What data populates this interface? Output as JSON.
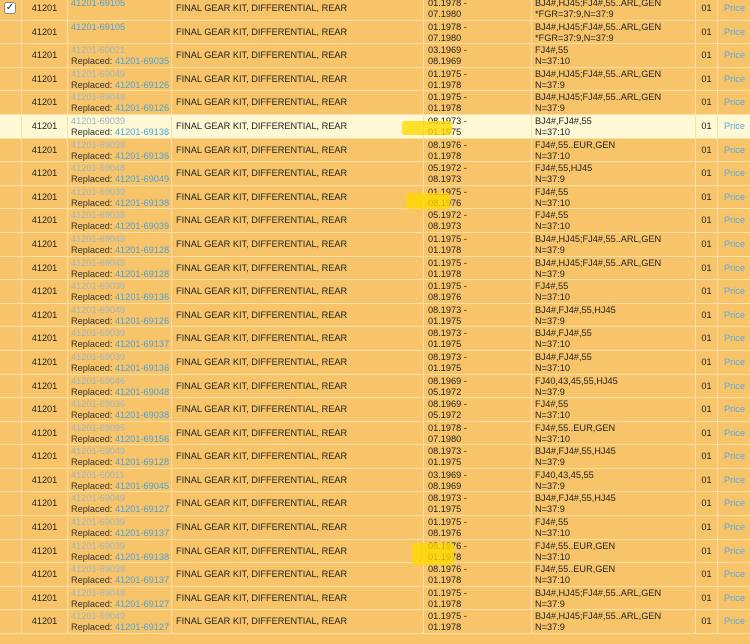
{
  "price_label": "Price",
  "replaced_label": "Replaced:",
  "checked_mark": "✓",
  "rows": [
    {
      "catalog": "41201",
      "part": "41201-69105",
      "replaced": "",
      "name": "FINAL GEAR KIT, DIFFERENTIAL, REAR",
      "date1": "01.1978 -",
      "date2": "07.1980",
      "app1": "BJ4#,HJ45;FJ4#,55..ARL,GEN",
      "app2": "*FGR=37:9,N=37:9",
      "qty": "01",
      "checked": true
    },
    {
      "catalog": "41201",
      "part": "41201-69105",
      "replaced": "",
      "name": "FINAL GEAR KIT, DIFFERENTIAL, REAR",
      "date1": "01.1978 -",
      "date2": "07.1980",
      "app1": "BJ4#,HJ45;FJ4#,55..ARL,GEN",
      "app2": "*FGR=37:9,N=37:9",
      "qty": "01"
    },
    {
      "catalog": "41201",
      "part": "41201-60021",
      "replaced": "41201-69035",
      "name": "FINAL GEAR KIT, DIFFERENTIAL, REAR",
      "date1": "03.1969 -",
      "date2": "08.1969",
      "app1": "FJ4#,55",
      "app2": "N=37:10",
      "qty": "01"
    },
    {
      "catalog": "41201",
      "part": "41201-69049",
      "replaced": "41201-69126",
      "name": "FINAL GEAR KIT, DIFFERENTIAL, REAR",
      "date1": "01.1975 -",
      "date2": "01.1978",
      "app1": "BJ4#,HJ45;FJ4#,55..ARL,GEN",
      "app2": "N=37:9",
      "qty": "01"
    },
    {
      "catalog": "41201",
      "part": "41201-69049",
      "replaced": "41201-69126",
      "name": "FINAL GEAR KIT, DIFFERENTIAL, REAR",
      "date1": "01.1975 -",
      "date2": "01.1978",
      "app1": "BJ4#,HJ45;FJ4#,55..ARL,GEN",
      "app2": "N=37:9",
      "qty": "01"
    },
    {
      "catalog": "41201",
      "part": "41201-69039",
      "replaced": "41201-69138",
      "name": "FINAL GEAR KIT, DIFFERENTIAL, REAR",
      "date1": "08.1973 -",
      "date2": "01.1975",
      "app1": "BJ4#,FJ4#,55",
      "app2": "N=37:10",
      "qty": "01",
      "highlight": true
    },
    {
      "catalog": "41201",
      "part": "41201-69039",
      "replaced": "41201-69136",
      "name": "FINAL GEAR KIT, DIFFERENTIAL, REAR",
      "date1": "08.1976 -",
      "date2": "01.1978",
      "app1": "FJ4#,55..EUR,GEN",
      "app2": "N=37:10",
      "qty": "01"
    },
    {
      "catalog": "41201",
      "part": "41201-69048",
      "replaced": "41201-69049",
      "name": "FINAL GEAR KIT, DIFFERENTIAL, REAR",
      "date1": "05.1972 -",
      "date2": "08.1973",
      "app1": "FJ4#,55,HJ45",
      "app2": "N=37:9",
      "qty": "01"
    },
    {
      "catalog": "41201",
      "part": "41201-69039",
      "replaced": "41201-69138",
      "name": "FINAL GEAR KIT, DIFFERENTIAL, REAR",
      "date1": "01.1975 -",
      "date2": "08.1976",
      "app1": "FJ4#,55",
      "app2": "N=37:10",
      "qty": "01"
    },
    {
      "catalog": "41201",
      "part": "41201-69038",
      "replaced": "41201-69039",
      "name": "FINAL GEAR KIT, DIFFERENTIAL, REAR",
      "date1": "05.1972 -",
      "date2": "08.1973",
      "app1": "FJ4#,55",
      "app2": "N=37:10",
      "qty": "01"
    },
    {
      "catalog": "41201",
      "part": "41201-69049",
      "replaced": "41201-69128",
      "name": "FINAL GEAR KIT, DIFFERENTIAL, REAR",
      "date1": "01.1975 -",
      "date2": "01.1978",
      "app1": "BJ4#,HJ45;FJ4#,55..ARL,GEN",
      "app2": "N=37:9",
      "qty": "01"
    },
    {
      "catalog": "41201",
      "part": "41201-69049",
      "replaced": "41201-69128",
      "name": "FINAL GEAR KIT, DIFFERENTIAL, REAR",
      "date1": "01.1975 -",
      "date2": "01.1978",
      "app1": "BJ4#,HJ45;FJ4#,55..ARL,GEN",
      "app2": "N=37:9",
      "qty": "01"
    },
    {
      "catalog": "41201",
      "part": "41201-69039",
      "replaced": "41201-69136",
      "name": "FINAL GEAR KIT, DIFFERENTIAL, REAR",
      "date1": "01.1975 -",
      "date2": "08.1976",
      "app1": "FJ4#,55",
      "app2": "N=37:10",
      "qty": "01"
    },
    {
      "catalog": "41201",
      "part": "41201-69049",
      "replaced": "41201-69126",
      "name": "FINAL GEAR KIT, DIFFERENTIAL, REAR",
      "date1": "08.1973 -",
      "date2": "01.1975",
      "app1": "BJ4#,FJ4#,55,HJ45",
      "app2": "N=37:9",
      "qty": "01"
    },
    {
      "catalog": "41201",
      "part": "41201-69039",
      "replaced": "41201-69137",
      "name": "FINAL GEAR KIT, DIFFERENTIAL, REAR",
      "date1": "08.1973 -",
      "date2": "01.1975",
      "app1": "BJ4#,FJ4#,55",
      "app2": "N=37:10",
      "qty": "01"
    },
    {
      "catalog": "41201",
      "part": "41201-69039",
      "replaced": "41201-69136",
      "name": "FINAL GEAR KIT, DIFFERENTIAL, REAR",
      "date1": "08.1973 -",
      "date2": "01.1975",
      "app1": "BJ4#,FJ4#,55",
      "app2": "N=37:10",
      "qty": "01"
    },
    {
      "catalog": "41201",
      "part": "41201-69046",
      "replaced": "41201-69048",
      "name": "FINAL GEAR KIT, DIFFERENTIAL, REAR",
      "date1": "08.1969 -",
      "date2": "05.1972",
      "app1": "FJ40,43,45,55,HJ45",
      "app2": "N=37:9",
      "qty": "01"
    },
    {
      "catalog": "41201",
      "part": "41201-69036",
      "replaced": "41201-69038",
      "name": "FINAL GEAR KIT, DIFFERENTIAL, REAR",
      "date1": "08.1969 -",
      "date2": "05.1972",
      "app1": "FJ4#,55",
      "app2": "N=37:10",
      "qty": "01"
    },
    {
      "catalog": "41201",
      "part": "41201-69095",
      "replaced": "41201-69156",
      "name": "FINAL GEAR KIT, DIFFERENTIAL, REAR",
      "date1": "01.1978 -",
      "date2": "07.1980",
      "app1": "FJ4#,55..EUR,GEN",
      "app2": "N=37:10",
      "qty": "01"
    },
    {
      "catalog": "41201",
      "part": "41201-69049",
      "replaced": "41201-69128",
      "name": "FINAL GEAR KIT, DIFFERENTIAL, REAR",
      "date1": "08.1973 -",
      "date2": "01.1975",
      "app1": "BJ4#,FJ4#,55,HJ45",
      "app2": "N=37:9",
      "qty": "01"
    },
    {
      "catalog": "41201",
      "part": "41201-60011",
      "replaced": "41201-69045",
      "name": "FINAL GEAR KIT, DIFFERENTIAL, REAR",
      "date1": "03.1969 -",
      "date2": "08.1969",
      "app1": "FJ40,43,45,55",
      "app2": "N=37:9",
      "qty": "01"
    },
    {
      "catalog": "41201",
      "part": "41201-69049",
      "replaced": "41201-69127",
      "name": "FINAL GEAR KIT, DIFFERENTIAL, REAR",
      "date1": "08.1973 -",
      "date2": "01.1975",
      "app1": "BJ4#,FJ4#,55,HJ45",
      "app2": "N=37:9",
      "qty": "01"
    },
    {
      "catalog": "41201",
      "part": "41201-69039",
      "replaced": "41201-69137",
      "name": "FINAL GEAR KIT, DIFFERENTIAL, REAR",
      "date1": "01.1975 -",
      "date2": "08.1976",
      "app1": "FJ4#,55",
      "app2": "N=37:10",
      "qty": "01"
    },
    {
      "catalog": "41201",
      "part": "41201-69039",
      "replaced": "41201-69138",
      "name": "FINAL GEAR KIT, DIFFERENTIAL, REAR",
      "date1": "08.1976 -",
      "date2": "01.1978",
      "app1": "FJ4#,55..EUR,GEN",
      "app2": "N=37:10",
      "qty": "01"
    },
    {
      "catalog": "41201",
      "part": "41201-69039",
      "replaced": "41201-69137",
      "name": "FINAL GEAR KIT, DIFFERENTIAL, REAR",
      "date1": "08.1976 -",
      "date2": "01.1978",
      "app1": "FJ4#,55..EUR,GEN",
      "app2": "N=37:10",
      "qty": "01"
    },
    {
      "catalog": "41201",
      "part": "41201-69049",
      "replaced": "41201-69127",
      "name": "FINAL GEAR KIT, DIFFERENTIAL, REAR",
      "date1": "01.1975 -",
      "date2": "01.1978",
      "app1": "BJ4#,HJ45;FJ4#,55..ARL,GEN",
      "app2": "N=37:9",
      "qty": "01"
    },
    {
      "catalog": "41201",
      "part": "41201-69049",
      "replaced": "41201-69127",
      "name": "FINAL GEAR KIT, DIFFERENTIAL, REAR",
      "date1": "01.1975 -",
      "date2": "01.1978",
      "app1": "BJ4#,HJ45;FJ4#,55..ARL,GEN",
      "app2": "N=37:9",
      "qty": "01"
    }
  ]
}
